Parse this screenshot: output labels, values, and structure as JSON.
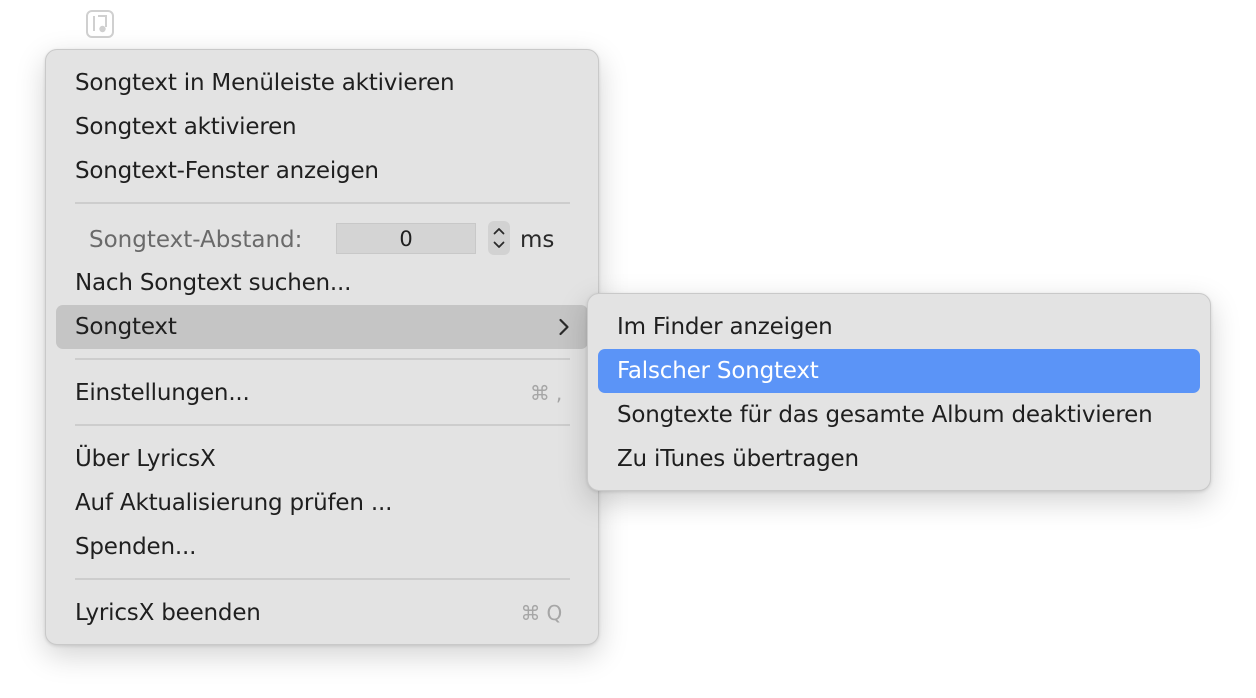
{
  "menubar": {
    "app_icon": "music-note-icon"
  },
  "main_menu": {
    "items": [
      {
        "label": "Songtext in Menüleiste aktivieren"
      },
      {
        "label": "Songtext aktivieren"
      },
      {
        "label": "Songtext-Fenster anzeigen"
      }
    ],
    "offset": {
      "label": "Songtext-Abstand:",
      "value": "0",
      "unit": "ms"
    },
    "search_label": "Nach Songtext suchen...",
    "songtext_label": "Songtext",
    "settings": {
      "label": "Einstellungen...",
      "shortcut": "⌘ ,"
    },
    "about_label": "Über LyricsX",
    "update_label": "Auf Aktualisierung prüfen ...",
    "donate_label": "Spenden...",
    "quit": {
      "label": "LyricsX beenden",
      "shortcut": "⌘ Q"
    }
  },
  "submenu": {
    "items": [
      {
        "label": "Im Finder anzeigen"
      },
      {
        "label": "Falscher Songtext"
      },
      {
        "label": "Songtexte für das gesamte Album deaktivieren"
      },
      {
        "label": "Zu iTunes übertragen"
      }
    ]
  },
  "colors": {
    "menu_background": "#e3e3e3",
    "hover_background": "#c5c5c5",
    "selection_accent": "#5b94f7",
    "shortcut_text": "#a6a6a6"
  }
}
